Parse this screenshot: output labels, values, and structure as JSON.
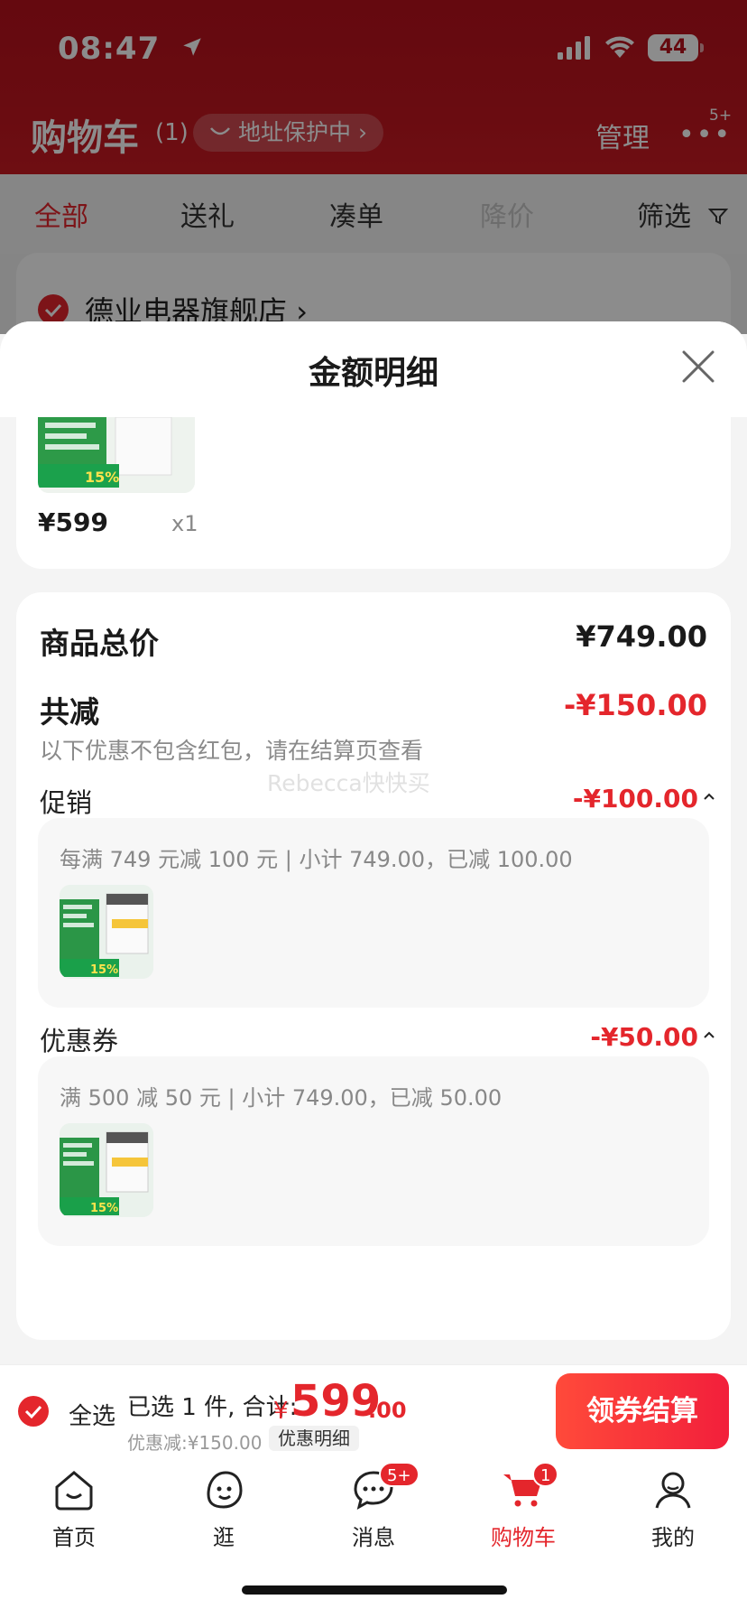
{
  "status_bar": {
    "time": "08:47",
    "battery": "44"
  },
  "cart_header": {
    "title": "购物车",
    "count": "(1)",
    "address_protect": "地址保护中",
    "manage": "管理",
    "more_badge": "5+"
  },
  "filter_tabs": [
    {
      "label": "全部"
    },
    {
      "label": "送礼"
    },
    {
      "label": "凑单"
    },
    {
      "label": "降价"
    },
    {
      "label": "筛选"
    }
  ],
  "store": {
    "name": "德业电器旗舰店"
  },
  "sheet": {
    "title": "金额明细",
    "item": {
      "price": "¥599",
      "qty": "x1",
      "thumb_badge": "15%"
    },
    "total_label": "商品总价",
    "total_value": "¥749.00",
    "reduce_label": "共减",
    "reduce_value": "-¥150.00",
    "reduce_note": "以下优惠不包含红包，请在结算页查看",
    "watermark": "Rebecca快快买",
    "promo": {
      "label": "促销",
      "value": "-¥100.00",
      "text": "每满 749 元减 100 元 | 小计 749.00，已减 100.00",
      "thumb_badge": "15%"
    },
    "coupon": {
      "label": "优惠券",
      "value": "-¥50.00",
      "text": "满 500 减 50 元 | 小计 749.00，已减 50.00",
      "thumb_badge": "15%"
    }
  },
  "checkout": {
    "select_all": "全选",
    "summary": "已选 1 件, 合计:",
    "currency": "¥",
    "total_int": "599",
    "total_dec": ".00",
    "discount": "优惠减:¥150.00",
    "detail_link": "优惠明细",
    "button": "领券结算"
  },
  "tabbar": {
    "items": [
      {
        "label": "首页"
      },
      {
        "label": "逛"
      },
      {
        "label": "消息",
        "badge": "5+"
      },
      {
        "label": "购物车",
        "badge": "1"
      },
      {
        "label": "我的"
      }
    ]
  },
  "colors": {
    "accent": "#e4262c",
    "header_bg": "#b8111d"
  }
}
